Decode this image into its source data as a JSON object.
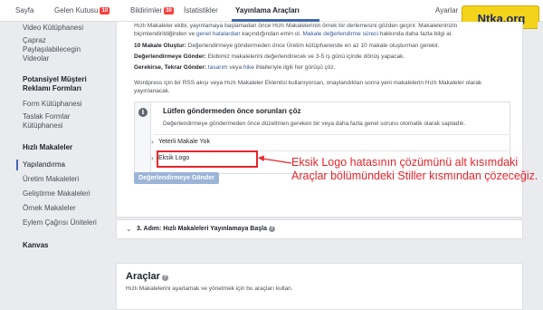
{
  "topnav": {
    "tabs": [
      {
        "label": "Sayfa"
      },
      {
        "label": "Gelen Kutusu",
        "badge": "10"
      },
      {
        "label": "Bildirimler",
        "badge": "30"
      },
      {
        "label": "İstatistikler"
      },
      {
        "label": "Yayınlama Araçları"
      },
      {
        "label": "Ayarlar"
      }
    ]
  },
  "watermark": "Ntka.org",
  "sidebar": {
    "items": [
      {
        "label": "Video Kütüphanesi",
        "type": "item"
      },
      {
        "label": "Çapraz Paylaşılabilecegin Videolar",
        "type": "item"
      },
      {
        "label": "Potansiyel Müşteri Reklamı Formları",
        "type": "head"
      },
      {
        "label": "Form Kütüphanesi",
        "type": "item"
      },
      {
        "label": "Taslak Formlar Kütüphanesi",
        "type": "item"
      },
      {
        "label": "Hızlı Makaleler",
        "type": "head"
      },
      {
        "label": "Yapılandırma",
        "type": "selected"
      },
      {
        "label": "Üretim Makaleleri",
        "type": "item"
      },
      {
        "label": "Geliştirme Makaleleri",
        "type": "item"
      },
      {
        "label": "Örnek Makaleler",
        "type": "item"
      },
      {
        "label": "Eylem Çağrısı Üniteleri",
        "type": "item"
      },
      {
        "label": "Kanvas",
        "type": "head"
      }
    ]
  },
  "main": {
    "intro_line1": "Hızlı Makaleler ekibi, yayınlamaya başlamadan önce Hızlı Makalelerinin örnek bir derlemesini gözden geçirir. Makalelerinizin",
    "intro_line2_a": "biçimlendirildiğinden ve ",
    "intro_line2_link": "genel hatalardan",
    "intro_line2_b": " kaçındığından emin ol. ",
    "intro_line2_link2": "Makale değerlendirme süreci",
    "intro_line2_c": " hakkında daha fazla bilgi al.",
    "req1_bold": "10 Makale Oluştur:",
    "req1_text": " Değerlendirmeye göndermeden önce Üretim kütüphanende en az 10 makale oluşturman gerekir.",
    "req2_bold": "Değerlendirmeye Gönder:",
    "req2_text": " Ekibimiz makalelerini değerlendirecek ve 3-5 iş günü içinde dönüş yapacak.",
    "req3_bold": "Gerekirse, Tekrar Gönder:",
    "req3_text_a": " ",
    "req3_link": "tasarım",
    "req3_text_b": " veya ",
    "req3_link2": "hike",
    "req3_text_c": " ihlalleriyle ilgili her görüşü çöz.",
    "rss_line1": "Wordpress için bir RSS akışı veya Hızlı Makaleler Eklentisi kullanıyorsan, onaylandıktan sonra yeni makalelerin Hızlı Makaleler olarak",
    "rss_line2": "yayınlanacak.",
    "info_title": "Lütfen göndermeden önce sorunları çöz",
    "info_desc": "Değerlendirmeye göndermeden önce düzeltmen gereken bir veya daha fazla genel sorunu otomatik olarak saptadık.",
    "issues": [
      {
        "label": "Yeterli Makale Yok"
      },
      {
        "label": "Eksik Logo"
      }
    ],
    "submit_button": "Değerlendirmeye Gönder",
    "step3_title": "3. Adım: Hızlı Makaleleri Yayınlamaya Başla",
    "step3_icon": "?",
    "tools_title": "Araçlar",
    "tools_desc": "Hızlı Makalelerini ayarlamak ve yönetmek için bu araçları kullan."
  },
  "annotation": {
    "text": "Eksik Logo hatasının çözümünü alt kısımdaki Araçlar bölümündeki Stiller kısmından çözeceğiz.",
    "color": "#e8252b"
  }
}
